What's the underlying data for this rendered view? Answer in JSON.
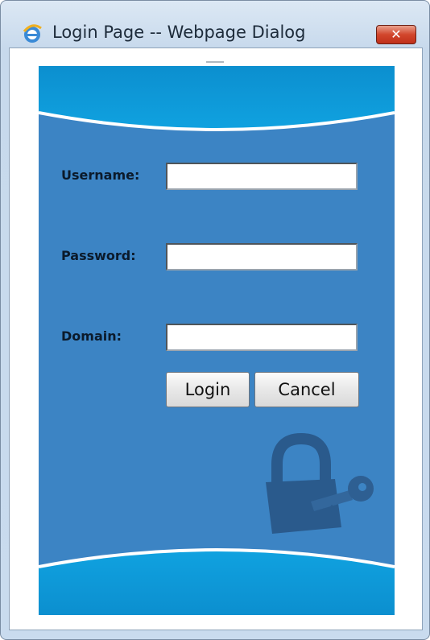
{
  "window": {
    "title": "Login Page -- Webpage Dialog",
    "close_label": "✕"
  },
  "form": {
    "username_label": "Username:",
    "password_label": "Password:",
    "domain_label": "Domain:",
    "username_value": "",
    "password_value": "",
    "domain_value": "",
    "login_label": "Login",
    "cancel_label": "Cancel"
  },
  "colors": {
    "panel": "#3c84c4",
    "wave": "#0e9ad8",
    "lock": "#2a5a8c"
  },
  "icons": {
    "title_icon": "internet-explorer-icon",
    "decoration": "padlock-key-icon"
  }
}
